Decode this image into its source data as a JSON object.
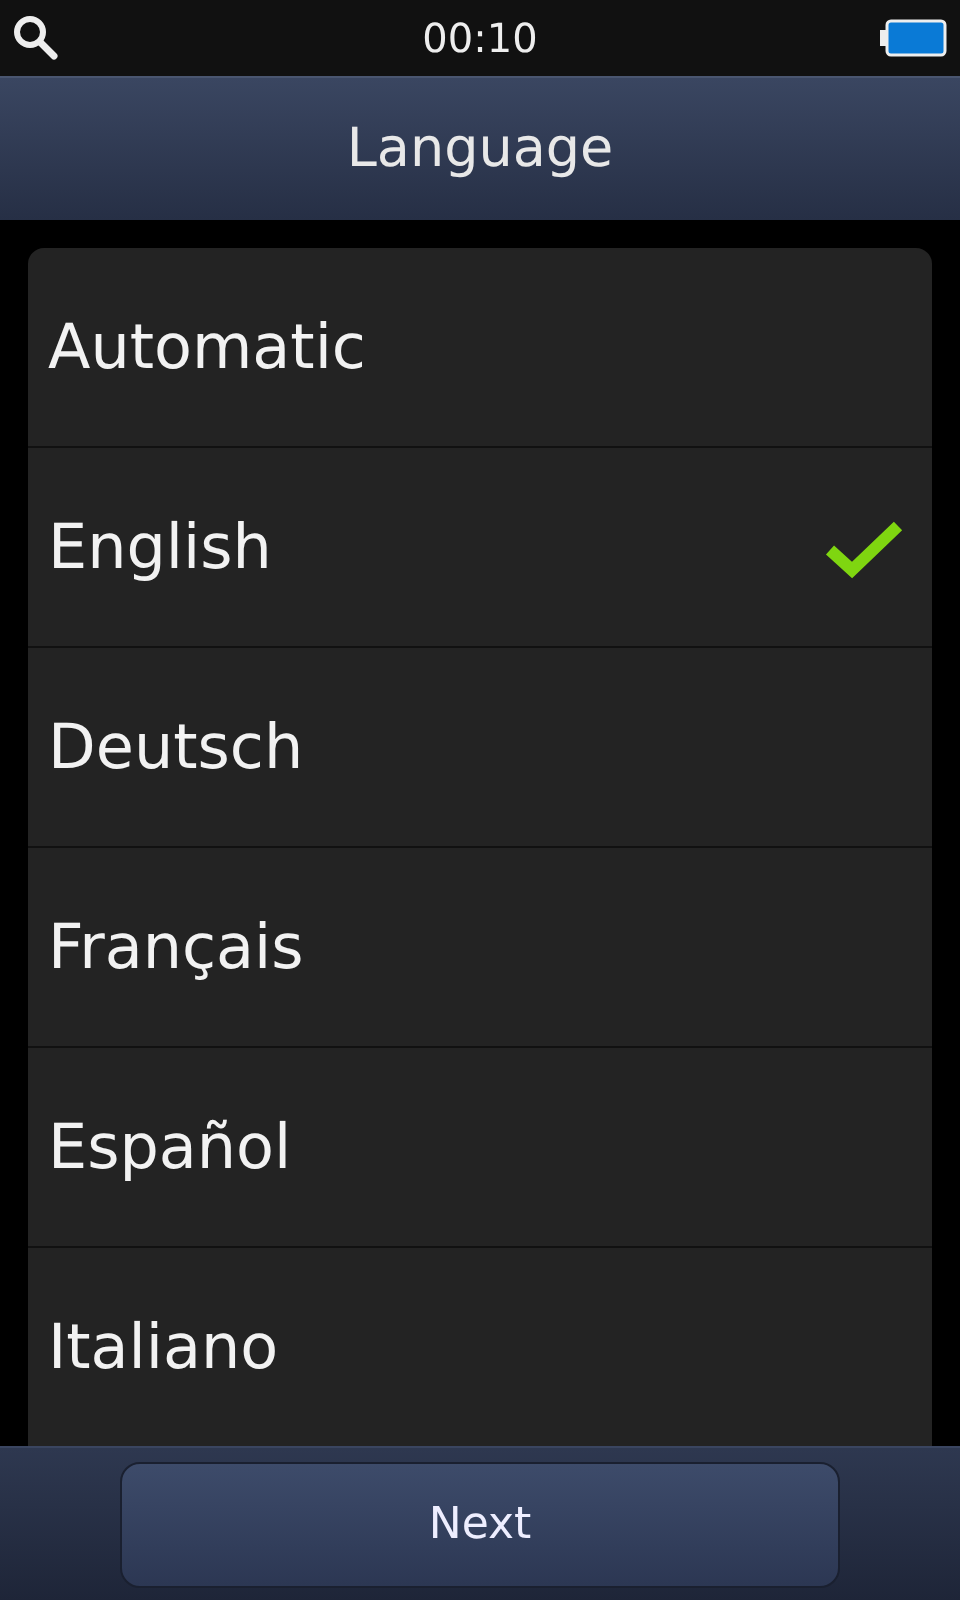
{
  "status_bar": {
    "time": "00:10"
  },
  "title": "Language",
  "languages": [
    {
      "label": "Automatic",
      "selected": false
    },
    {
      "label": "English",
      "selected": true
    },
    {
      "label": "Deutsch",
      "selected": false
    },
    {
      "label": "Français",
      "selected": false
    },
    {
      "label": "Español",
      "selected": false
    },
    {
      "label": "Italiano",
      "selected": false
    }
  ],
  "buttons": [
    "Next"
  ]
}
